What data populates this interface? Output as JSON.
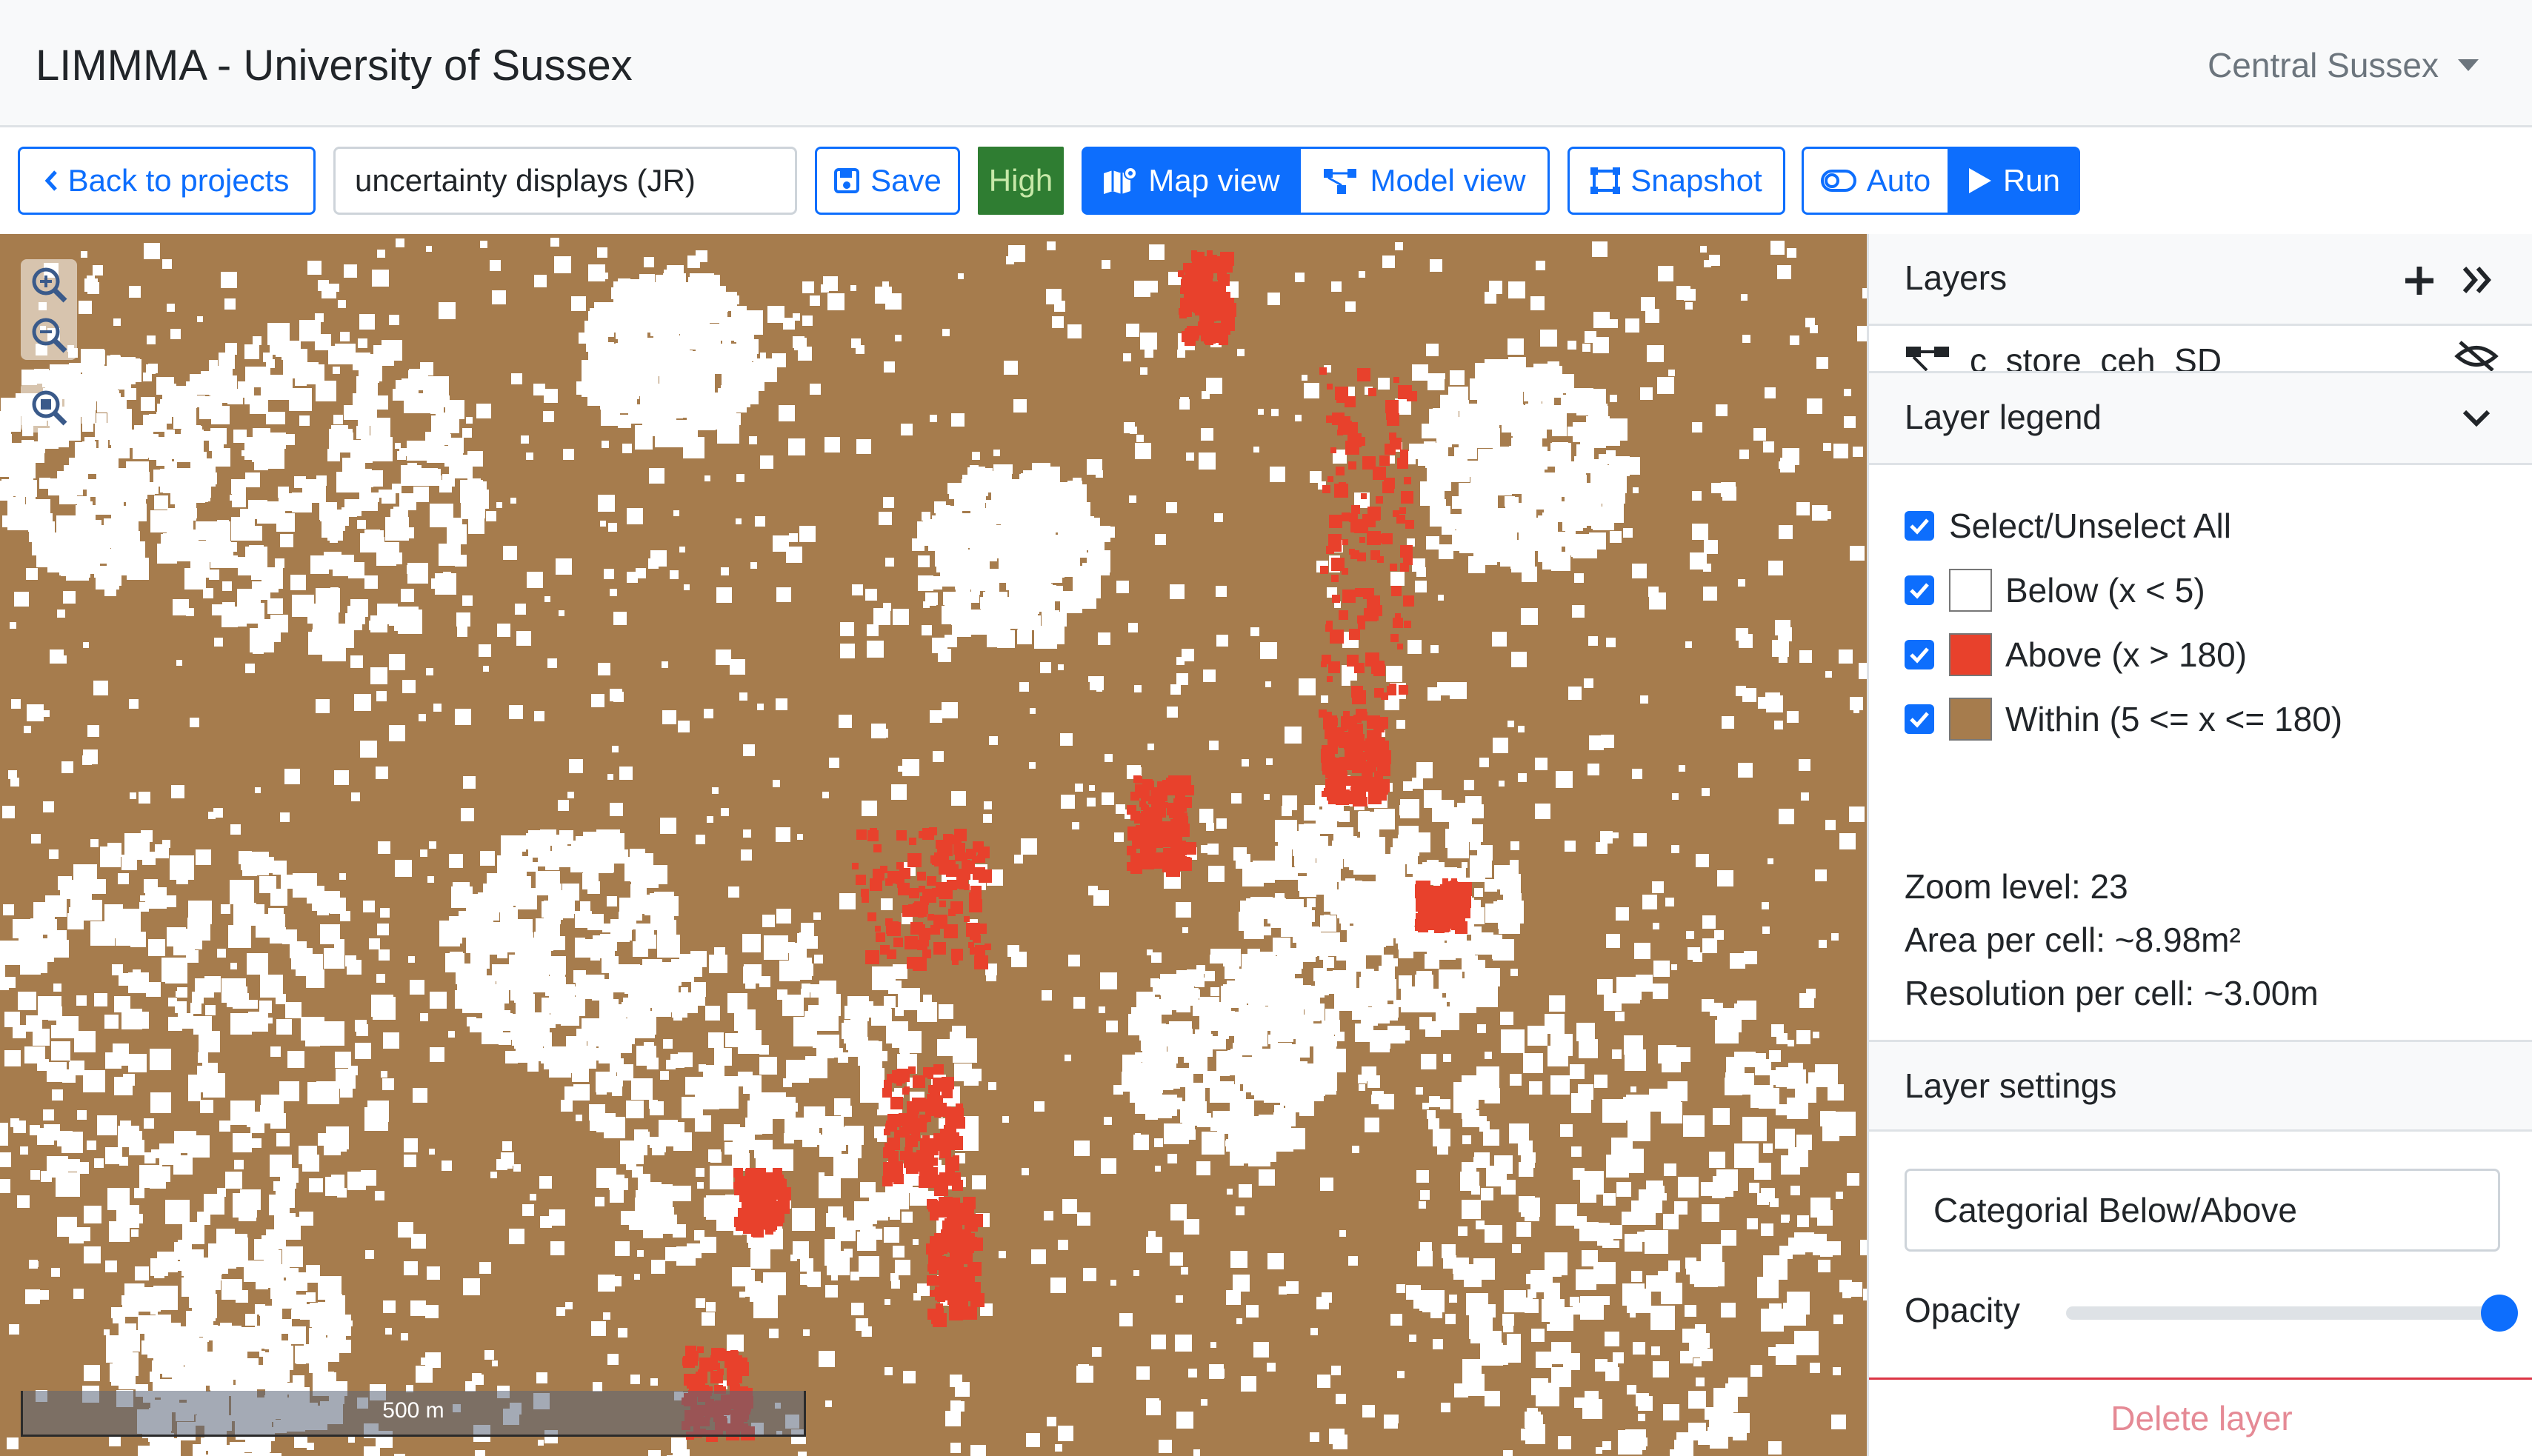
{
  "navbar": {
    "brand": "LIMMMA - University of Sussex",
    "region": "Central Sussex"
  },
  "toolbar": {
    "back_label": "Back to projects",
    "project_title": "uncertainty displays (JR)",
    "save_label": "Save",
    "quality_badge": "High",
    "map_view_label": "Map view",
    "model_view_label": "Model view",
    "snapshot_label": "Snapshot",
    "auto_label": "Auto",
    "run_label": "Run"
  },
  "map": {
    "scale_label": "500 m",
    "colors": {
      "within": "#a67c4d",
      "below": "#ffffff",
      "above": "#e8412c"
    }
  },
  "panel": {
    "layers_title": "Layers",
    "layer_name": "c_store_ceh_SD",
    "legend_title": "Layer legend",
    "legend": {
      "select_all": "Select/Unselect All",
      "items": [
        {
          "label": "Below (x < 5)",
          "color": "#ffffff"
        },
        {
          "label": "Above (x > 180)",
          "color": "#e8412c"
        },
        {
          "label": "Within (5 <= x <= 180)",
          "color": "#a67c4d"
        }
      ]
    },
    "zoom_level": "Zoom level: 23",
    "area_per_cell": "Area per cell: ~8.98m²",
    "resolution_per_cell": "Resolution per cell: ~3.00m",
    "settings_title": "Layer settings",
    "display_mode": "Categorial Below/Above",
    "opacity_label": "Opacity",
    "opacity_value": 1.0,
    "delete_label": "Delete layer"
  }
}
